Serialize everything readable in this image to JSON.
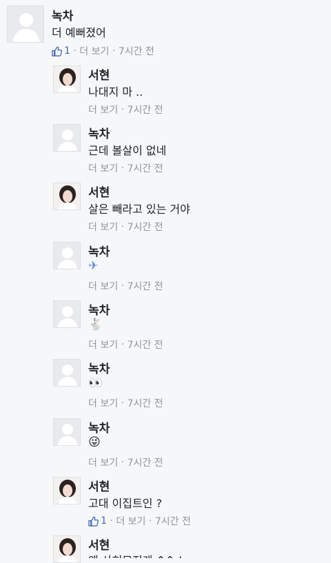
{
  "colors": {
    "accent": "#4267b2",
    "meta_text": "#90949c",
    "background": "#f6f7f9"
  },
  "comments": [
    {
      "name": "녹차",
      "text": "더 예뻐졌어",
      "likes": "1",
      "more": "더 보기",
      "time": "7시간 전",
      "avatar": "default",
      "reply": false
    },
    {
      "name": "서현",
      "text": "나대지 마 ..",
      "more": "더 보기",
      "time": "7시간 전",
      "avatar": "photo",
      "reply": true
    },
    {
      "name": "녹차",
      "text": "근데 볼살이 없네",
      "more": "더 보기",
      "time": "7시간 전",
      "avatar": "default",
      "reply": true
    },
    {
      "name": "서현",
      "text": "살은 빼라고 있는 거야",
      "more": "더 보기",
      "time": "7시간 전",
      "avatar": "photo",
      "reply": true
    },
    {
      "name": "녹차",
      "text": "✈",
      "more": "더 보기",
      "time": "7시간 전",
      "avatar": "default",
      "reply": true,
      "icon": "airplane-emoji"
    },
    {
      "name": "녹차",
      "text": "🐇",
      "more": "더 보기",
      "time": "7시간 전",
      "avatar": "default",
      "reply": true,
      "icon": "rabbit-emoji"
    },
    {
      "name": "녹차",
      "text": "👀",
      "more": "더 보기",
      "time": "7시간 전",
      "avatar": "default",
      "reply": true,
      "icon": "eyes-emoji"
    },
    {
      "name": "녹차",
      "text": "😜",
      "more": "더 보기",
      "time": "7시간 전",
      "avatar": "default",
      "reply": true,
      "icon": "winking-tongue-emoji"
    },
    {
      "name": "서현",
      "text": "고대 이집트인 ?",
      "likes": "1",
      "more": "더 보기",
      "time": "7시간 전",
      "avatar": "photo",
      "reply": true
    },
    {
      "name": "서현",
      "text": "왜 사혀모지게 ^^ !",
      "avatar": "photo",
      "reply": true
    }
  ]
}
